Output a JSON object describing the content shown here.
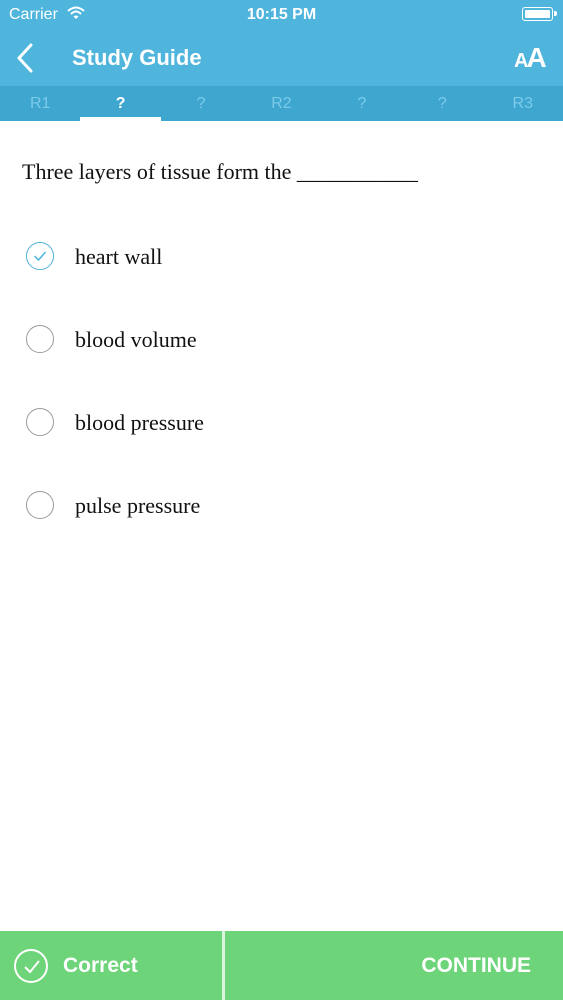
{
  "status": {
    "carrier": "Carrier",
    "time": "10:15 PM"
  },
  "nav": {
    "title": "Study Guide",
    "font_small": "A",
    "font_large": "A"
  },
  "tabs": [
    {
      "label": "R1",
      "active": false
    },
    {
      "label": "?",
      "active": true
    },
    {
      "label": "?",
      "active": false
    },
    {
      "label": "R2",
      "active": false
    },
    {
      "label": "?",
      "active": false
    },
    {
      "label": "?",
      "active": false
    },
    {
      "label": "R3",
      "active": false
    }
  ],
  "question": {
    "text": "Three layers of tissue form the ___________"
  },
  "answers": [
    {
      "label": "heart wall",
      "selected": true
    },
    {
      "label": "blood volume",
      "selected": false
    },
    {
      "label": "blood pressure",
      "selected": false
    },
    {
      "label": "pulse pressure",
      "selected": false
    }
  ],
  "footer": {
    "result_label": "Correct",
    "continue_label": "CONTINUE"
  },
  "colors": {
    "primary": "#4fb5dd",
    "tab_bar": "#3fa6cf",
    "success": "#6ed47a"
  }
}
